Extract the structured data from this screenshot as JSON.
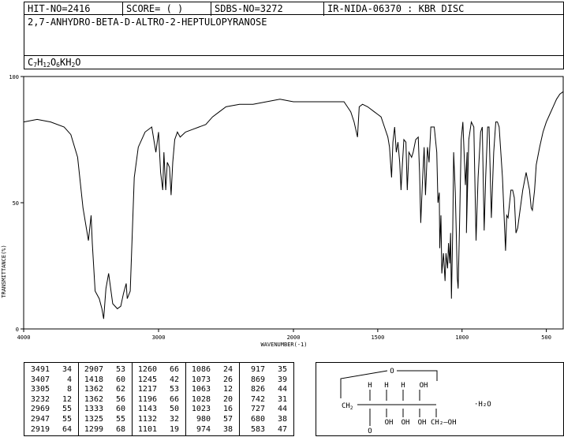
{
  "header": {
    "hit_no": "HIT-NO=2416",
    "score": "SCORE=  (   )",
    "sdbs_no": "SDBS-NO=3272",
    "ir_id": "IR-NIDA-06370 : KBR DISC"
  },
  "compound": {
    "name": "2,7-ANHYDRO-BETA-D-ALTRO-2-HEPTULOPYRANOSE",
    "formula_parts": [
      {
        "t": "C",
        "sub": false
      },
      {
        "t": "7",
        "sub": true
      },
      {
        "t": "H",
        "sub": false
      },
      {
        "t": "12",
        "sub": true
      },
      {
        "t": "O",
        "sub": false
      },
      {
        "t": "6",
        "sub": true
      },
      {
        "t": "KH",
        "sub": false
      },
      {
        "t": "2",
        "sub": true
      },
      {
        "t": "O",
        "sub": false
      }
    ]
  },
  "chart_data": {
    "type": "line",
    "xlabel": "WAVENUMBER(-1)",
    "ylabel": "TRANSMITTANCE(%)",
    "xlim": [
      4000,
      400
    ],
    "ylim": [
      0,
      100
    ],
    "x_ticks": [
      4000,
      3000,
      2000,
      1500,
      1000,
      500
    ],
    "y_ticks": [
      0,
      50,
      100
    ],
    "series": [
      {
        "x": [
          4000,
          3900,
          3800,
          3700,
          3650,
          3600,
          3560,
          3520,
          3500,
          3491,
          3470,
          3440,
          3420,
          3407,
          3390,
          3370,
          3340,
          3305,
          3280,
          3260,
          3240,
          3232,
          3210,
          3180,
          3150,
          3100,
          3050,
          3020,
          3000,
          2985,
          2969,
          2960,
          2947,
          2935,
          2919,
          2907,
          2895,
          2880,
          2860,
          2840,
          2800,
          2750,
          2700,
          2650,
          2600,
          2550,
          2500,
          2400,
          2300,
          2200,
          2100,
          2000,
          1900,
          1800,
          1700,
          1680,
          1660,
          1640,
          1620,
          1610,
          1590,
          1560,
          1520,
          1500,
          1480,
          1460,
          1440,
          1430,
          1418,
          1410,
          1400,
          1390,
          1380,
          1370,
          1362,
          1355,
          1345,
          1333,
          1325,
          1315,
          1299,
          1290,
          1275,
          1260,
          1252,
          1245,
          1235,
          1225,
          1217,
          1205,
          1196,
          1185,
          1165,
          1150,
          1143,
          1135,
          1132,
          1125,
          1120,
          1110,
          1101,
          1095,
          1086,
          1080,
          1073,
          1068,
          1063,
          1055,
          1050,
          1040,
          1028,
          1023,
          1015,
          1005,
          995,
          980,
          970,
          974,
          960,
          945,
          930,
          917,
          905,
          890,
          880,
          869,
          860,
          848,
          840,
          826,
          812,
          800,
          790,
          780,
          760,
          742,
          735,
          727,
          710,
          700,
          690,
          680,
          670,
          660,
          640,
          620,
          600,
          590,
          583,
          570,
          560,
          540,
          520,
          500,
          480,
          460,
          440,
          420,
          400
        ],
        "y": [
          82,
          83,
          82,
          80,
          77,
          68,
          48,
          35,
          45,
          34,
          15,
          12,
          8,
          4,
          16,
          22,
          10,
          8,
          9,
          14,
          18,
          12,
          15,
          60,
          72,
          78,
          80,
          70,
          78,
          62,
          55,
          70,
          55,
          66,
          64,
          53,
          66,
          75,
          78,
          76,
          78,
          79,
          80,
          81,
          84,
          86,
          88,
          89,
          89,
          90,
          91,
          90,
          90,
          90,
          90,
          88,
          86,
          82,
          76,
          88,
          89,
          88,
          86,
          85,
          84,
          80,
          76,
          72,
          60,
          74,
          80,
          70,
          74,
          66,
          55,
          64,
          75,
          74,
          55,
          70,
          68,
          70,
          75,
          76,
          62,
          42,
          58,
          72,
          53,
          72,
          66,
          80,
          80,
          70,
          50,
          54,
          32,
          45,
          22,
          30,
          19,
          30,
          24,
          34,
          26,
          38,
          12,
          40,
          70,
          54,
          20,
          16,
          40,
          75,
          82,
          57,
          70,
          38,
          75,
          82,
          80,
          35,
          60,
          78,
          80,
          39,
          60,
          80,
          80,
          44,
          70,
          82,
          82,
          80,
          60,
          31,
          45,
          44,
          55,
          55,
          52,
          38,
          40,
          45,
          55,
          62,
          55,
          48,
          47,
          55,
          65,
          72,
          78,
          82,
          85,
          88,
          91,
          93,
          94
        ]
      }
    ]
  },
  "peak_table": {
    "columns": [
      [
        [
          "3491",
          "34"
        ],
        [
          "3407",
          "4"
        ],
        [
          "3305",
          "8"
        ],
        [
          "3232",
          "12"
        ],
        [
          "2969",
          "55"
        ],
        [
          "2947",
          "55"
        ],
        [
          "2919",
          "64"
        ]
      ],
      [
        [
          "2907",
          "53"
        ],
        [
          "1418",
          "60"
        ],
        [
          "1362",
          "62"
        ],
        [
          "1362",
          "56"
        ],
        [
          "1333",
          "60"
        ],
        [
          "1325",
          "55"
        ],
        [
          "1299",
          "68"
        ]
      ],
      [
        [
          "1260",
          "66"
        ],
        [
          "1245",
          "42"
        ],
        [
          "1217",
          "53"
        ],
        [
          "1196",
          "66"
        ],
        [
          "1143",
          "50"
        ],
        [
          "1132",
          "32"
        ],
        [
          "1101",
          "19"
        ]
      ],
      [
        [
          "1086",
          "24"
        ],
        [
          "1073",
          "26"
        ],
        [
          "1063",
          "12"
        ],
        [
          "1028",
          "20"
        ],
        [
          "1023",
          "16"
        ],
        [
          "980",
          "57"
        ],
        [
          "974",
          "38"
        ]
      ],
      [
        [
          "917",
          "35"
        ],
        [
          "869",
          "39"
        ],
        [
          "826",
          "44"
        ],
        [
          "742",
          "31"
        ],
        [
          "727",
          "44"
        ],
        [
          "680",
          "38"
        ],
        [
          "583",
          "47"
        ]
      ]
    ]
  },
  "structure": {
    "ring_o_top": "O",
    "ring_o_bottom": "O",
    "ch2": "CH",
    "ch2_sub": "2",
    "h_labels": [
      "H",
      "H",
      "H"
    ],
    "oh_top": "OH",
    "oh_bottom": [
      "OH",
      "OH",
      "OH"
    ],
    "ch2oh": "CH₂—OH",
    "water": "·H₂O"
  }
}
